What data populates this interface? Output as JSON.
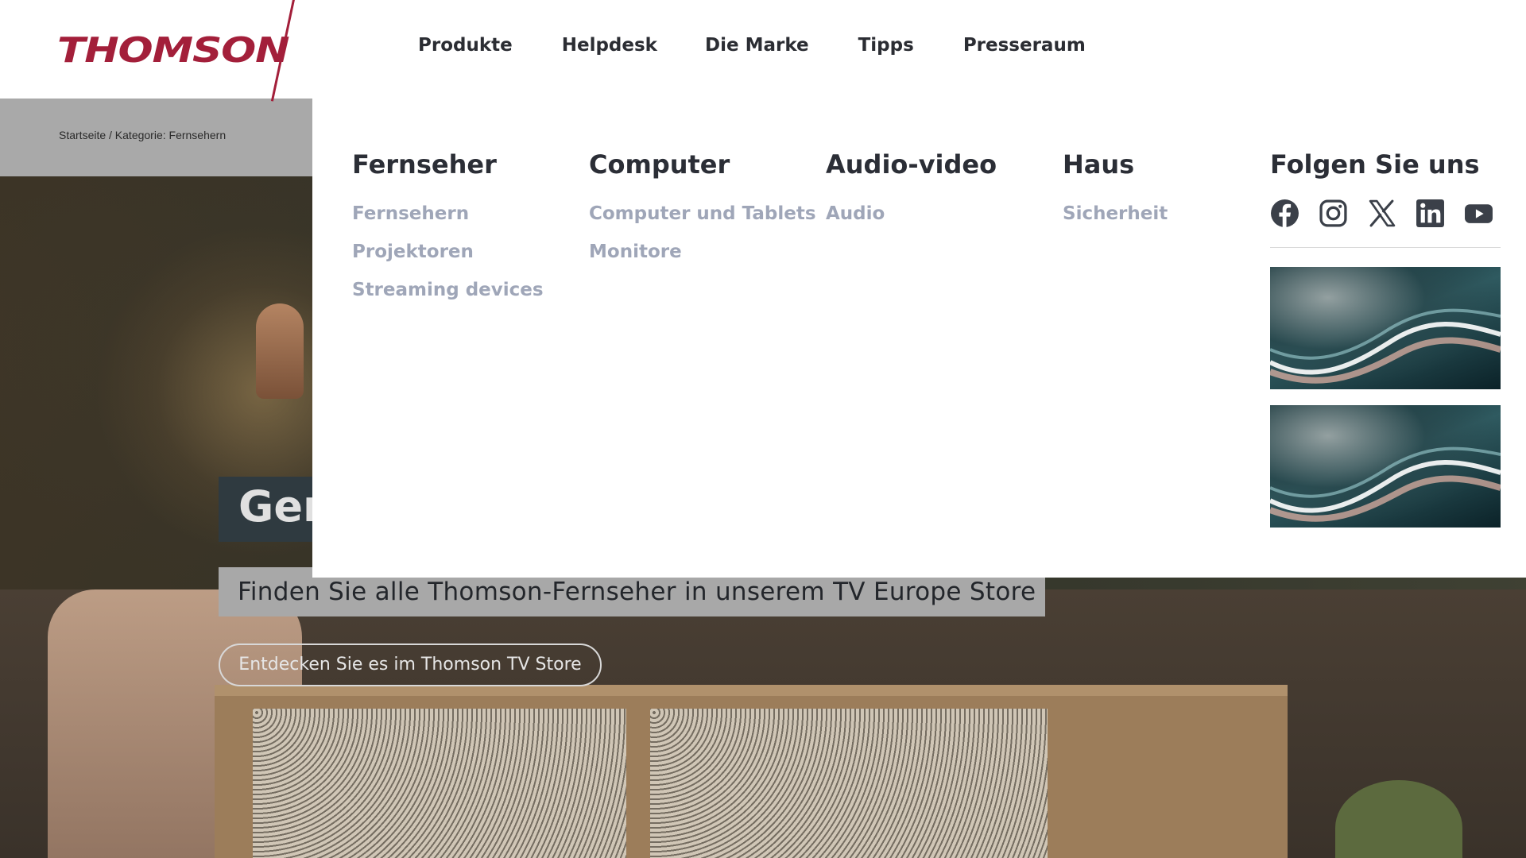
{
  "brand": {
    "logo_text": "THOMSON",
    "color": "#a31f3a"
  },
  "nav": {
    "items": [
      {
        "label": "Produkte"
      },
      {
        "label": "Helpdesk"
      },
      {
        "label": "Die Marke"
      },
      {
        "label": "Tipps"
      },
      {
        "label": "Presseraum"
      }
    ]
  },
  "breadcrumb": {
    "text": "Startseite / Kategorie: Fernsehern"
  },
  "hero": {
    "title": "Ger",
    "subtitle": "Finden Sie alle Thomson-Fernseher in unserem TV Europe Store",
    "cta": "Entdecken Sie es im Thomson TV Store"
  },
  "mega_menu": {
    "columns": [
      {
        "title": "Fernseher",
        "links": [
          "Fernsehern",
          "Projektoren",
          "Streaming devices"
        ]
      },
      {
        "title": "Computer",
        "links": [
          "Computer und Tablets",
          "Monitore"
        ]
      },
      {
        "title": "Audio-video",
        "links": [
          "Audio"
        ]
      },
      {
        "title": "Haus",
        "links": [
          "Sicherheit"
        ]
      }
    ],
    "follow": {
      "title": "Folgen Sie uns",
      "icons": [
        "facebook-icon",
        "instagram-icon",
        "x-twitter-icon",
        "linkedin-icon",
        "youtube-icon"
      ],
      "icon_color": "#3b4049"
    }
  }
}
